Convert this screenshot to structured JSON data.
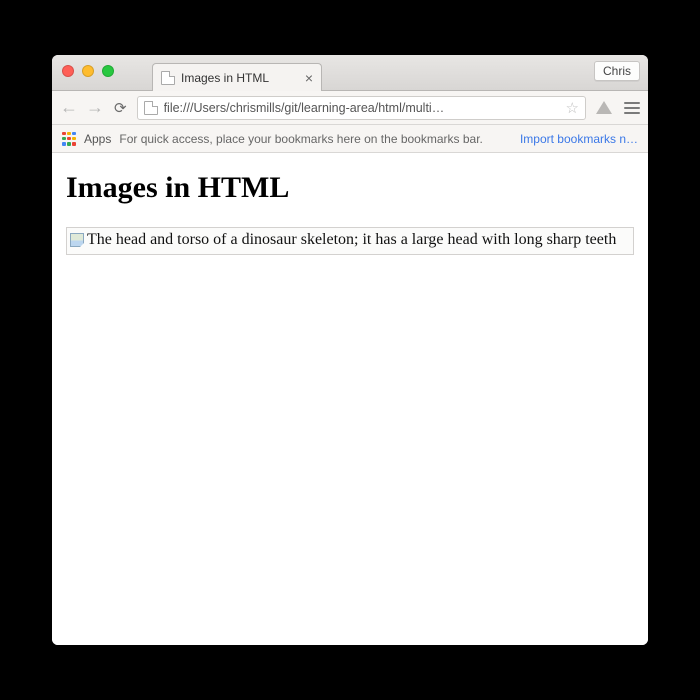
{
  "window": {
    "user_label": "Chris"
  },
  "tab": {
    "title": "Images in HTML"
  },
  "toolbar": {
    "url": "file:///Users/chrismills/git/learning-area/html/multi…"
  },
  "bookmarks_bar": {
    "apps_label": "Apps",
    "hint": "For quick access, place your bookmarks here on the bookmarks bar.",
    "import_link": "Import bookmarks n…"
  },
  "page": {
    "heading": "Images in HTML",
    "broken_image_alt": "The head and torso of a dinosaur skeleton; it has a large head with long sharp teeth"
  }
}
